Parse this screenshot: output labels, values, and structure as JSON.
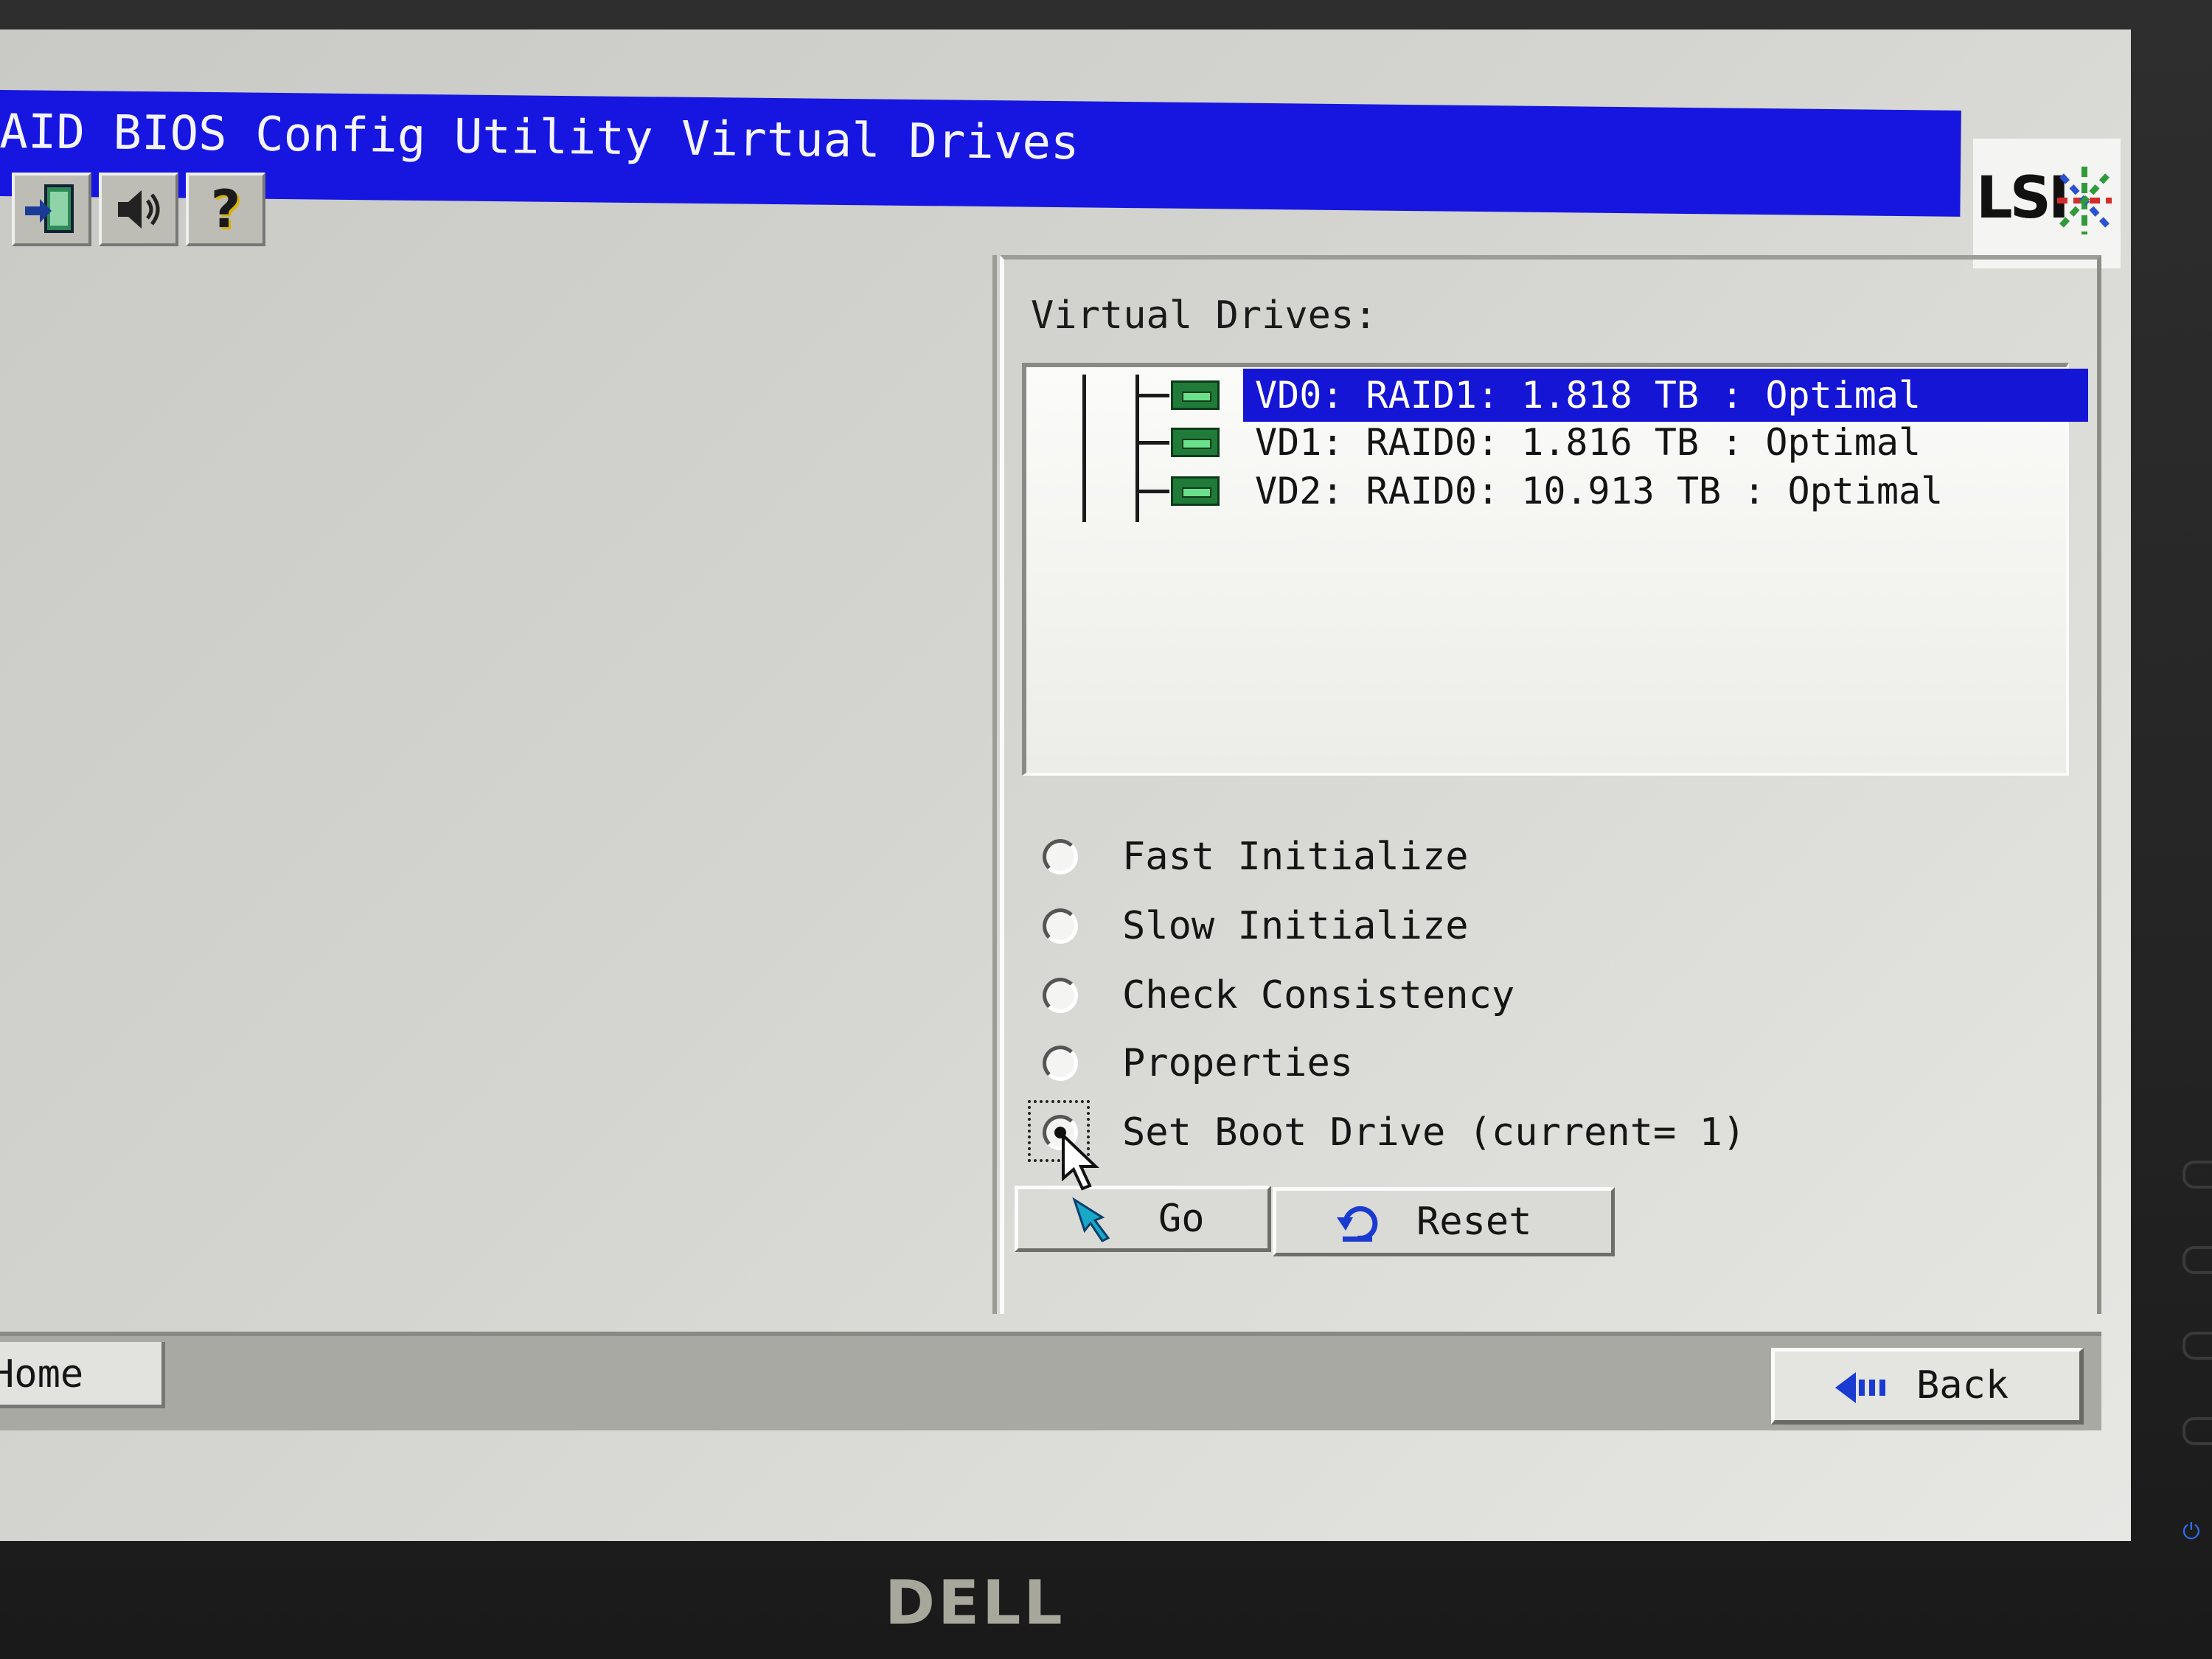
{
  "window": {
    "title": "AID BIOS Config Utility Virtual Drives",
    "vendor_logo": "LSI",
    "title_bar_color": "#1616e0"
  },
  "toolbar": {
    "buttons": [
      {
        "icon": "exit-icon"
      },
      {
        "icon": "speaker-icon"
      },
      {
        "icon": "help-icon",
        "glyph": "?"
      }
    ]
  },
  "virtual_drives": {
    "label": "Virtual Drives:",
    "items": [
      {
        "text": "VD0: RAID1: 1.818 TB : Optimal",
        "selected": true
      },
      {
        "text": "VD1: RAID0: 1.816 TB : Optimal",
        "selected": false
      },
      {
        "text": "VD2: RAID0: 10.913 TB : Optimal",
        "selected": false
      }
    ],
    "selection_color": "#1515d6"
  },
  "actions": {
    "options": [
      {
        "label": "Fast Initialize",
        "checked": false
      },
      {
        "label": "Slow Initialize",
        "checked": false
      },
      {
        "label": "Check Consistency",
        "checked": false
      },
      {
        "label": "Properties",
        "checked": false
      },
      {
        "label": "Set Boot Drive (current= 1)",
        "checked": true
      }
    ],
    "go_label": "Go",
    "reset_label": "Reset"
  },
  "footer": {
    "home_label": "Home",
    "back_label": "Back"
  },
  "monitor": {
    "brand": "DELL"
  }
}
